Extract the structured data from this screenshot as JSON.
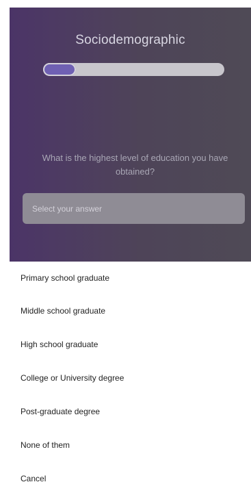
{
  "header": {
    "title": "Sociodemographic"
  },
  "progress": {
    "fraction": 0.18
  },
  "question": {
    "text": "What is the highest level of education you have obtained?"
  },
  "answer_select": {
    "placeholder": "Select your answer"
  },
  "options": [
    {
      "label": "Primary school graduate"
    },
    {
      "label": "Middle school graduate"
    },
    {
      "label": "High school graduate"
    },
    {
      "label": "College or University degree"
    },
    {
      "label": "Post-graduate degree"
    },
    {
      "label": "None of them"
    },
    {
      "label": "Cancel"
    }
  ],
  "colors": {
    "hero_start": "#4b3467",
    "hero_end": "#4f4a56",
    "progress_fill": "#6f60b3",
    "progress_track": "#c8c6cc",
    "select_bg": "#8f8c95"
  }
}
